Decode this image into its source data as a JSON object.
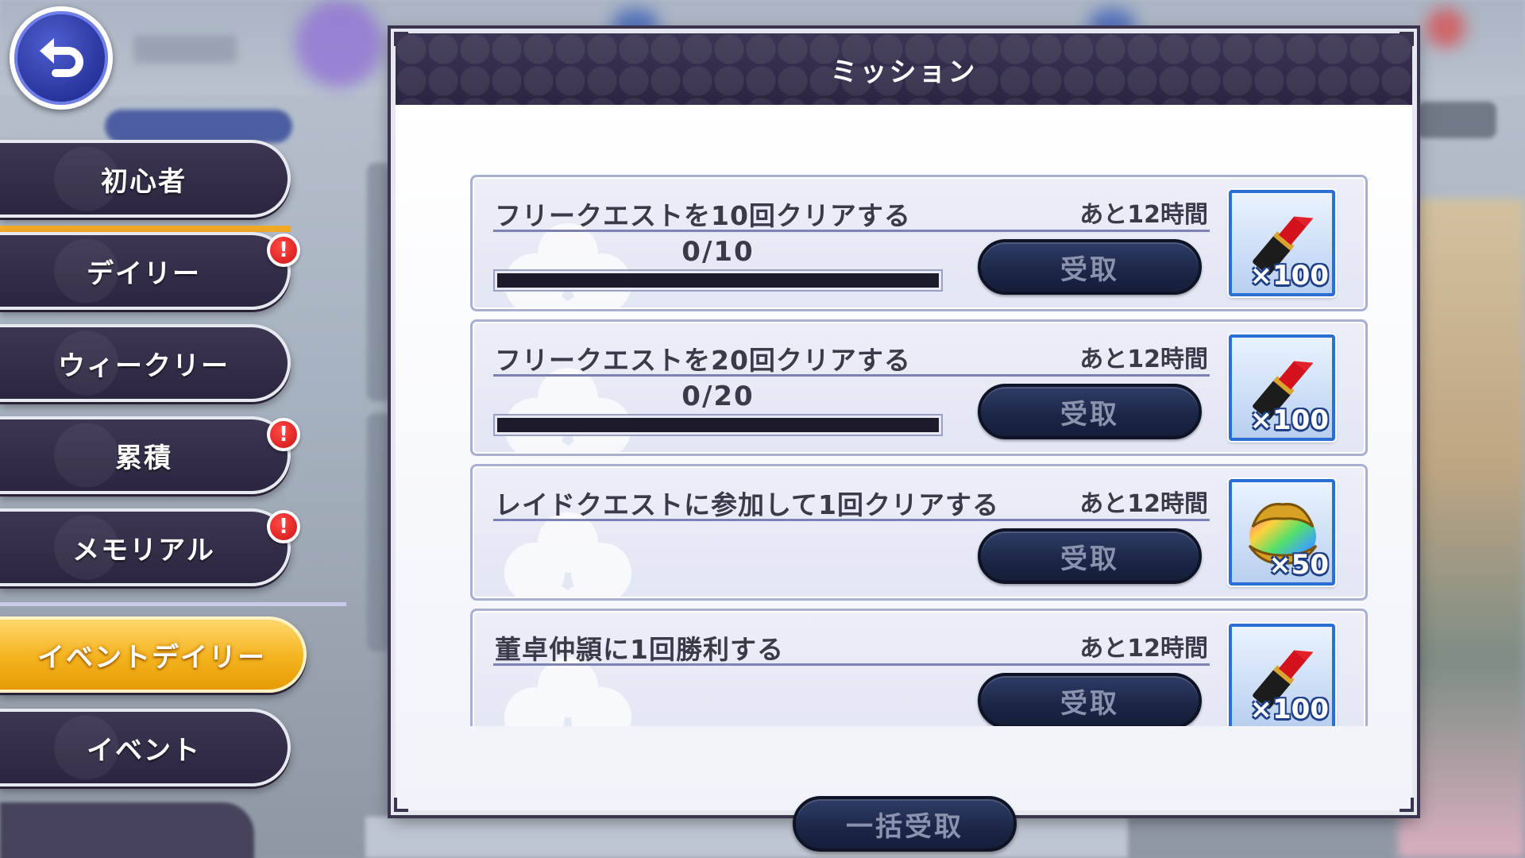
{
  "dialog": {
    "title": "ミッション",
    "claim_all_label": "一括受取"
  },
  "sidebar": {
    "tabs": [
      {
        "label": "初心者",
        "notify": false
      },
      {
        "label": "デイリー",
        "notify": true
      },
      {
        "label": "ウィークリー",
        "notify": false
      },
      {
        "label": "累積",
        "notify": true
      },
      {
        "label": "メモリアル",
        "notify": true
      },
      {
        "label": "イベントデイリー",
        "notify": false,
        "active": true
      },
      {
        "label": "イベント",
        "notify": false
      }
    ],
    "badge_glyph": "!"
  },
  "missions": [
    {
      "title": "フリークエストを10回クリアする",
      "time_left": "あと12時間",
      "progress": "0/10",
      "progress_fraction": 0,
      "claim_label": "受取",
      "reward": {
        "icon": "lipstick-icon",
        "qty": "×100"
      }
    },
    {
      "title": "フリークエストを20回クリアする",
      "time_left": "あと12時間",
      "progress": "0/20",
      "progress_fraction": 0,
      "claim_label": "受取",
      "reward": {
        "icon": "lipstick-icon",
        "qty": "×100"
      }
    },
    {
      "title": "レイドクエストに参加して1回クリアする",
      "time_left": "あと12時間",
      "claim_label": "受取",
      "reward": {
        "icon": "rainbow-orb-icon",
        "qty": "×50"
      }
    },
    {
      "title": "董卓仲頴に1回勝利する",
      "time_left": "あと12時間",
      "claim_label": "受取",
      "reward": {
        "icon": "lipstick-icon",
        "qty": "×100"
      }
    }
  ],
  "colors": {
    "accent_active_tab": "#f4b31e",
    "dialog_header": "#2b2542",
    "button": "#1b2646",
    "badge": "#e01b1b"
  }
}
